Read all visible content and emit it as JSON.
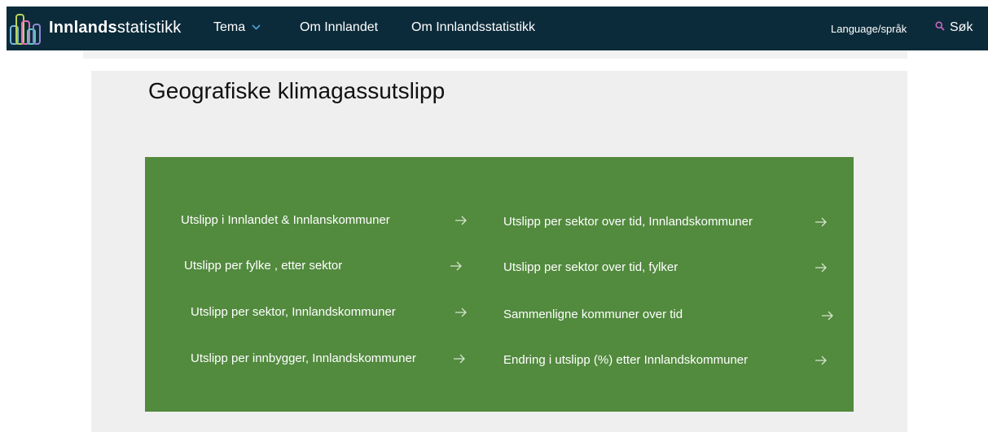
{
  "header": {
    "logo_bold": "Innlands",
    "logo_light": "statistikk",
    "nav": {
      "tema": "Tema",
      "om_innlandet": "Om Innlandet",
      "om_innlandsstatistikk": "Om Innlandsstatistikk"
    },
    "language": "Language/språk",
    "search": "Søk"
  },
  "main": {
    "title": "Geografiske klimagassutslipp",
    "left_links": [
      "Utslipp i Innlandet & Innlanskommuner",
      "Utslipp per fylke , etter sektor",
      "Utslipp per sektor, Innlandskommuner",
      "Utslipp per innbygger, Innlandskommuner"
    ],
    "right_links": [
      "Utslipp per sektor over tid, Innlandskommuner",
      "Utslipp per sektor over tid, fylker",
      "Sammenligne kommuner over tid",
      "Endring i utslipp (%) etter Innlandskommuner"
    ]
  },
  "colors": {
    "navbar": "#0c2b3a",
    "green_box": "#528a3e",
    "panel": "#efefef",
    "accent_chevron": "#4fa3d8",
    "search_icon": "#d36ac7"
  },
  "icons": {
    "logo": "city-bars-logo-icon",
    "tema_dropdown": "chevron-down-icon",
    "search": "search-icon",
    "link_arrow": "arrow-right-icon"
  }
}
